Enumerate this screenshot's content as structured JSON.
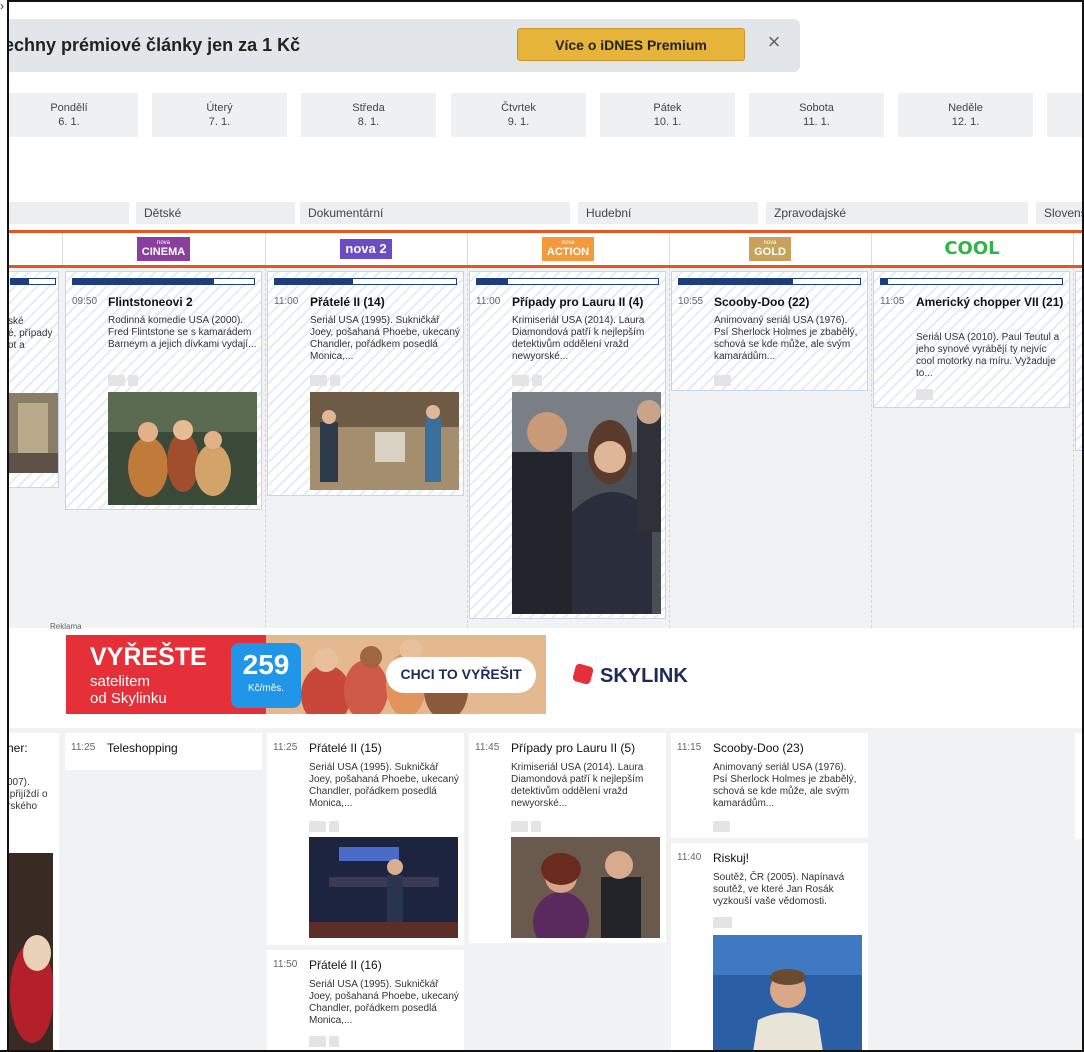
{
  "promo": {
    "text": "echny prémiové články jen za 1 Kč",
    "button": "Více o iDNES Premium",
    "close": "×"
  },
  "days": [
    {
      "name": "Pondělí",
      "date": "6. 1."
    },
    {
      "name": "Úterý",
      "date": "7. 1."
    },
    {
      "name": "Středa",
      "date": "8. 1."
    },
    {
      "name": "Čtvrtek",
      "date": "9. 1."
    },
    {
      "name": "Pátek",
      "date": "10. 1."
    },
    {
      "name": "Sobota",
      "date": "11. 1."
    },
    {
      "name": "Neděle",
      "date": "12. 1."
    }
  ],
  "genres": [
    "Dětské",
    "Dokumentární",
    "Hudební",
    "Zpravodajské",
    "Slovens"
  ],
  "channels": [
    {
      "name": "CINEMA",
      "sup": "nova",
      "bg": "#8a3f9c"
    },
    {
      "name": "nova 2",
      "sup": "",
      "bg": "#6c4cc4"
    },
    {
      "name": "ACTION",
      "sup": "nova",
      "bg": "#f29a3c"
    },
    {
      "name": "GOLD",
      "sup": "nova",
      "bg": "#c8a25a"
    },
    {
      "name": "COOL",
      "sup": "",
      "bg": "#2fb34a"
    }
  ],
  "colors": {
    "accent": "#e8561f",
    "progress": "#1d3e7a",
    "promo_button": "#e7b43a"
  },
  "progress": {
    "col0": 0.42,
    "cinema": 0.78,
    "nova2": 0.43,
    "action": 0.17,
    "gold": 0.63,
    "cool": 0.04
  },
  "partial_left": {
    "desc": "ské\né, případy\not a",
    "title2": "her:",
    "desc2": "007).\n přijíždí o\nrského"
  },
  "programs_top": [
    {
      "time": "09:50",
      "title": "Flintstoneovi 2",
      "desc": "Rodinná komedie USA (2000). Fred Flintstone se s kamarádem Barneym a jejich dívkami vydají..."
    },
    {
      "time": "11:00",
      "title": "Přátelé II (14)",
      "desc": "Seriál USA (1995). Sukničkář Joey, pošahaná Phoebe, ukecaný Chandler, pořádkem posedlá Monica,..."
    },
    {
      "time": "11:00",
      "title": "Případy pro Lauru II (4)",
      "desc": "Krimiseriál USA (2014). Laura Diamondová patří k nejlepším detektivům oddělení vražd newyorské..."
    },
    {
      "time": "10:55",
      "title": "Scooby-Doo (22)",
      "desc": "Animovaný seriál USA (1976). Psí Sherlock Holmes je zbabělý, schová se kde může, ale svým kamarádům..."
    },
    {
      "time": "11:05",
      "title": "Americký chopper VII (21)",
      "desc": "Seriál USA (2010). Paul Teutul a jeho synové vyrábějí ty nejvíc cool motorky na míru. Vyžaduje to..."
    }
  ],
  "ad": {
    "label": "Reklama",
    "headline": "VYŘEŠTE",
    "sub1": "satelitem",
    "sub2": "od Skylinku",
    "price": "259",
    "price_unit": "Kč/měs.",
    "cta": "CHCI TO VYŘEŠIT",
    "brand": "SKYLINK"
  },
  "programs_bottom": [
    {
      "time": "11:25",
      "title": "Teleshopping"
    },
    {
      "time": "11:25",
      "title": "Přátelé II (15)",
      "desc": "Seriál USA (1995). Sukničkář Joey, pošahaná Phoebe, ukecaný Chandler, pořádkem posedlá Monica,..."
    },
    {
      "time": "11:45",
      "title": "Případy pro Lauru II (5)",
      "desc": "Krimiseriál USA (2014). Laura Diamondová patří k nejlepším detektivům oddělení vražd newyorské..."
    },
    {
      "time": "11:15",
      "title": "Scooby-Doo (23)",
      "desc": "Animovaný seriál USA (1976). Psí Sherlock Holmes je zbabělý, schová se kde může, ale svým kamarádům..."
    },
    {
      "time": "11:50",
      "title": "Přátelé II (16)",
      "desc": "Seriál USA (1995). Sukničkář Joey, pošahaná Phoebe, ukecaný Chandler, pořádkem posedlá Monica,..."
    },
    {
      "time": "11:40",
      "title": "Riskuj!",
      "desc": "Soutěž, ČR (2005). Napínavá soutěž, ve které Jan Rosák vyzkouší vaše vědomosti."
    }
  ]
}
